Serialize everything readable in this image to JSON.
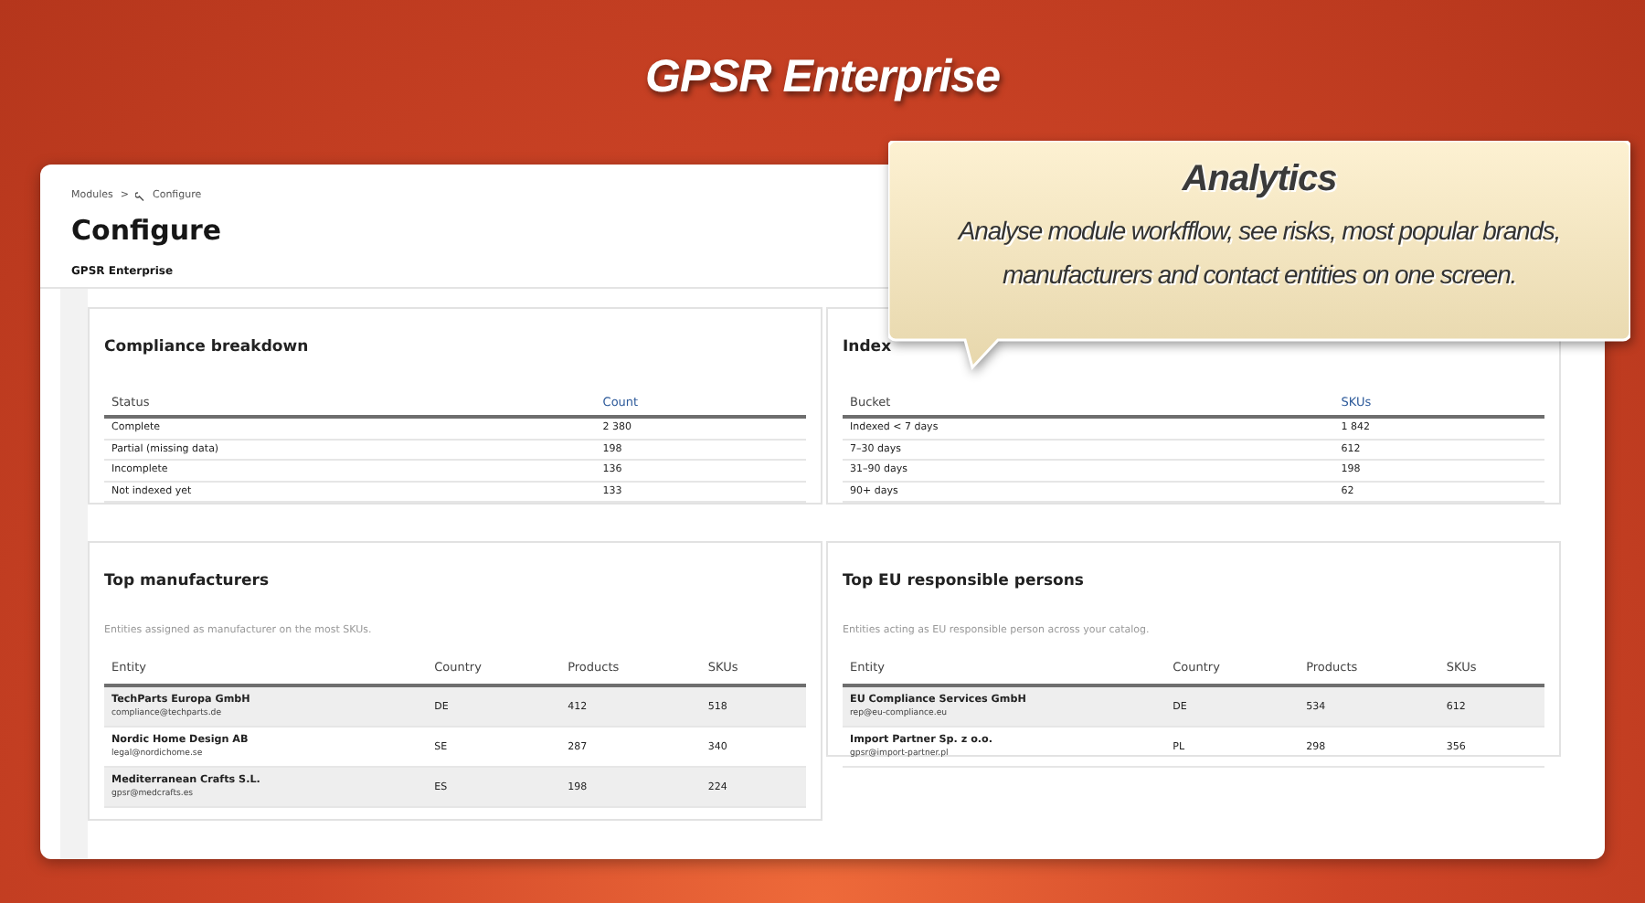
{
  "page_title": "GPSR Enterprise",
  "callout": {
    "title": "Analytics",
    "text": "Analyse module workfflow, see risks, most popular brands, manufacturers and contact entities on one screen."
  },
  "breadcrumb": {
    "items": [
      "Modules",
      "Configure"
    ],
    "separator": ">"
  },
  "header": {
    "title": "Configure",
    "subtitle": "GPSR Enterprise"
  },
  "panels": [
    {
      "kind": "simple",
      "title": "Compliance breakdown",
      "columns": [
        "Status",
        "Count"
      ],
      "rows": [
        [
          "Complete",
          "2 380"
        ],
        [
          "Partial (missing data)",
          "198"
        ],
        [
          "Incomplete",
          "136"
        ],
        [
          "Not indexed yet",
          "133"
        ]
      ]
    },
    {
      "kind": "simple",
      "title": "Index",
      "columns": [
        "Bucket",
        "SKUs"
      ],
      "rows": [
        [
          "Indexed < 7 days",
          "1 842"
        ],
        [
          "7–30 days",
          "612"
        ],
        [
          "31–90 days",
          "198"
        ],
        [
          "90+ days",
          "62"
        ]
      ]
    },
    {
      "kind": "entity",
      "title": "Top manufacturers",
      "description": "Entities assigned as manufacturer on the most SKUs.",
      "columns": [
        "Entity",
        "Country",
        "Products",
        "SKUs"
      ],
      "rows": [
        {
          "name": "TechParts Europa GmbH",
          "email": "compliance@techparts.de",
          "country": "DE",
          "products": "412",
          "skus": "518"
        },
        {
          "name": "Nordic Home Design AB",
          "email": "legal@nordichome.se",
          "country": "SE",
          "products": "287",
          "skus": "340"
        },
        {
          "name": "Mediterranean Crafts S.L.",
          "email": "gpsr@medcrafts.es",
          "country": "ES",
          "products": "198",
          "skus": "224"
        }
      ]
    },
    {
      "kind": "entity",
      "title": "Top EU responsible persons",
      "description": "Entities acting as EU responsible person across your catalog.",
      "columns": [
        "Entity",
        "Country",
        "Products",
        "SKUs"
      ],
      "rows": [
        {
          "name": "EU Compliance Services GmbH",
          "email": "rep@eu-compliance.eu",
          "country": "DE",
          "products": "534",
          "skus": "612"
        },
        {
          "name": "Import Partner Sp. z o.o.",
          "email": "gpsr@import-partner.pl",
          "country": "PL",
          "products": "298",
          "skus": "356"
        }
      ]
    }
  ]
}
